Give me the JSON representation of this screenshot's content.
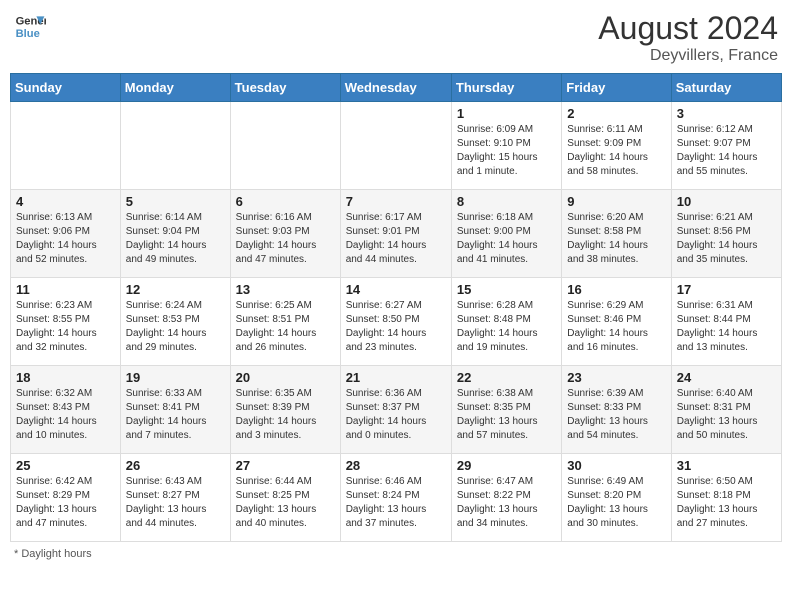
{
  "header": {
    "logo_line1": "General",
    "logo_line2": "Blue",
    "month_title": "August 2024",
    "location": "Deyvillers, France"
  },
  "days_of_week": [
    "Sunday",
    "Monday",
    "Tuesday",
    "Wednesday",
    "Thursday",
    "Friday",
    "Saturday"
  ],
  "weeks": [
    {
      "days": [
        {
          "num": "",
          "info": ""
        },
        {
          "num": "",
          "info": ""
        },
        {
          "num": "",
          "info": ""
        },
        {
          "num": "",
          "info": ""
        },
        {
          "num": "1",
          "info": "Sunrise: 6:09 AM\nSunset: 9:10 PM\nDaylight: 15 hours\nand 1 minute."
        },
        {
          "num": "2",
          "info": "Sunrise: 6:11 AM\nSunset: 9:09 PM\nDaylight: 14 hours\nand 58 minutes."
        },
        {
          "num": "3",
          "info": "Sunrise: 6:12 AM\nSunset: 9:07 PM\nDaylight: 14 hours\nand 55 minutes."
        }
      ]
    },
    {
      "days": [
        {
          "num": "4",
          "info": "Sunrise: 6:13 AM\nSunset: 9:06 PM\nDaylight: 14 hours\nand 52 minutes."
        },
        {
          "num": "5",
          "info": "Sunrise: 6:14 AM\nSunset: 9:04 PM\nDaylight: 14 hours\nand 49 minutes."
        },
        {
          "num": "6",
          "info": "Sunrise: 6:16 AM\nSunset: 9:03 PM\nDaylight: 14 hours\nand 47 minutes."
        },
        {
          "num": "7",
          "info": "Sunrise: 6:17 AM\nSunset: 9:01 PM\nDaylight: 14 hours\nand 44 minutes."
        },
        {
          "num": "8",
          "info": "Sunrise: 6:18 AM\nSunset: 9:00 PM\nDaylight: 14 hours\nand 41 minutes."
        },
        {
          "num": "9",
          "info": "Sunrise: 6:20 AM\nSunset: 8:58 PM\nDaylight: 14 hours\nand 38 minutes."
        },
        {
          "num": "10",
          "info": "Sunrise: 6:21 AM\nSunset: 8:56 PM\nDaylight: 14 hours\nand 35 minutes."
        }
      ]
    },
    {
      "days": [
        {
          "num": "11",
          "info": "Sunrise: 6:23 AM\nSunset: 8:55 PM\nDaylight: 14 hours\nand 32 minutes."
        },
        {
          "num": "12",
          "info": "Sunrise: 6:24 AM\nSunset: 8:53 PM\nDaylight: 14 hours\nand 29 minutes."
        },
        {
          "num": "13",
          "info": "Sunrise: 6:25 AM\nSunset: 8:51 PM\nDaylight: 14 hours\nand 26 minutes."
        },
        {
          "num": "14",
          "info": "Sunrise: 6:27 AM\nSunset: 8:50 PM\nDaylight: 14 hours\nand 23 minutes."
        },
        {
          "num": "15",
          "info": "Sunrise: 6:28 AM\nSunset: 8:48 PM\nDaylight: 14 hours\nand 19 minutes."
        },
        {
          "num": "16",
          "info": "Sunrise: 6:29 AM\nSunset: 8:46 PM\nDaylight: 14 hours\nand 16 minutes."
        },
        {
          "num": "17",
          "info": "Sunrise: 6:31 AM\nSunset: 8:44 PM\nDaylight: 14 hours\nand 13 minutes."
        }
      ]
    },
    {
      "days": [
        {
          "num": "18",
          "info": "Sunrise: 6:32 AM\nSunset: 8:43 PM\nDaylight: 14 hours\nand 10 minutes."
        },
        {
          "num": "19",
          "info": "Sunrise: 6:33 AM\nSunset: 8:41 PM\nDaylight: 14 hours\nand 7 minutes."
        },
        {
          "num": "20",
          "info": "Sunrise: 6:35 AM\nSunset: 8:39 PM\nDaylight: 14 hours\nand 3 minutes."
        },
        {
          "num": "21",
          "info": "Sunrise: 6:36 AM\nSunset: 8:37 PM\nDaylight: 14 hours\nand 0 minutes."
        },
        {
          "num": "22",
          "info": "Sunrise: 6:38 AM\nSunset: 8:35 PM\nDaylight: 13 hours\nand 57 minutes."
        },
        {
          "num": "23",
          "info": "Sunrise: 6:39 AM\nSunset: 8:33 PM\nDaylight: 13 hours\nand 54 minutes."
        },
        {
          "num": "24",
          "info": "Sunrise: 6:40 AM\nSunset: 8:31 PM\nDaylight: 13 hours\nand 50 minutes."
        }
      ]
    },
    {
      "days": [
        {
          "num": "25",
          "info": "Sunrise: 6:42 AM\nSunset: 8:29 PM\nDaylight: 13 hours\nand 47 minutes."
        },
        {
          "num": "26",
          "info": "Sunrise: 6:43 AM\nSunset: 8:27 PM\nDaylight: 13 hours\nand 44 minutes."
        },
        {
          "num": "27",
          "info": "Sunrise: 6:44 AM\nSunset: 8:25 PM\nDaylight: 13 hours\nand 40 minutes."
        },
        {
          "num": "28",
          "info": "Sunrise: 6:46 AM\nSunset: 8:24 PM\nDaylight: 13 hours\nand 37 minutes."
        },
        {
          "num": "29",
          "info": "Sunrise: 6:47 AM\nSunset: 8:22 PM\nDaylight: 13 hours\nand 34 minutes."
        },
        {
          "num": "30",
          "info": "Sunrise: 6:49 AM\nSunset: 8:20 PM\nDaylight: 13 hours\nand 30 minutes."
        },
        {
          "num": "31",
          "info": "Sunrise: 6:50 AM\nSunset: 8:18 PM\nDaylight: 13 hours\nand 27 minutes."
        }
      ]
    }
  ],
  "footer": {
    "note": "Daylight hours"
  }
}
